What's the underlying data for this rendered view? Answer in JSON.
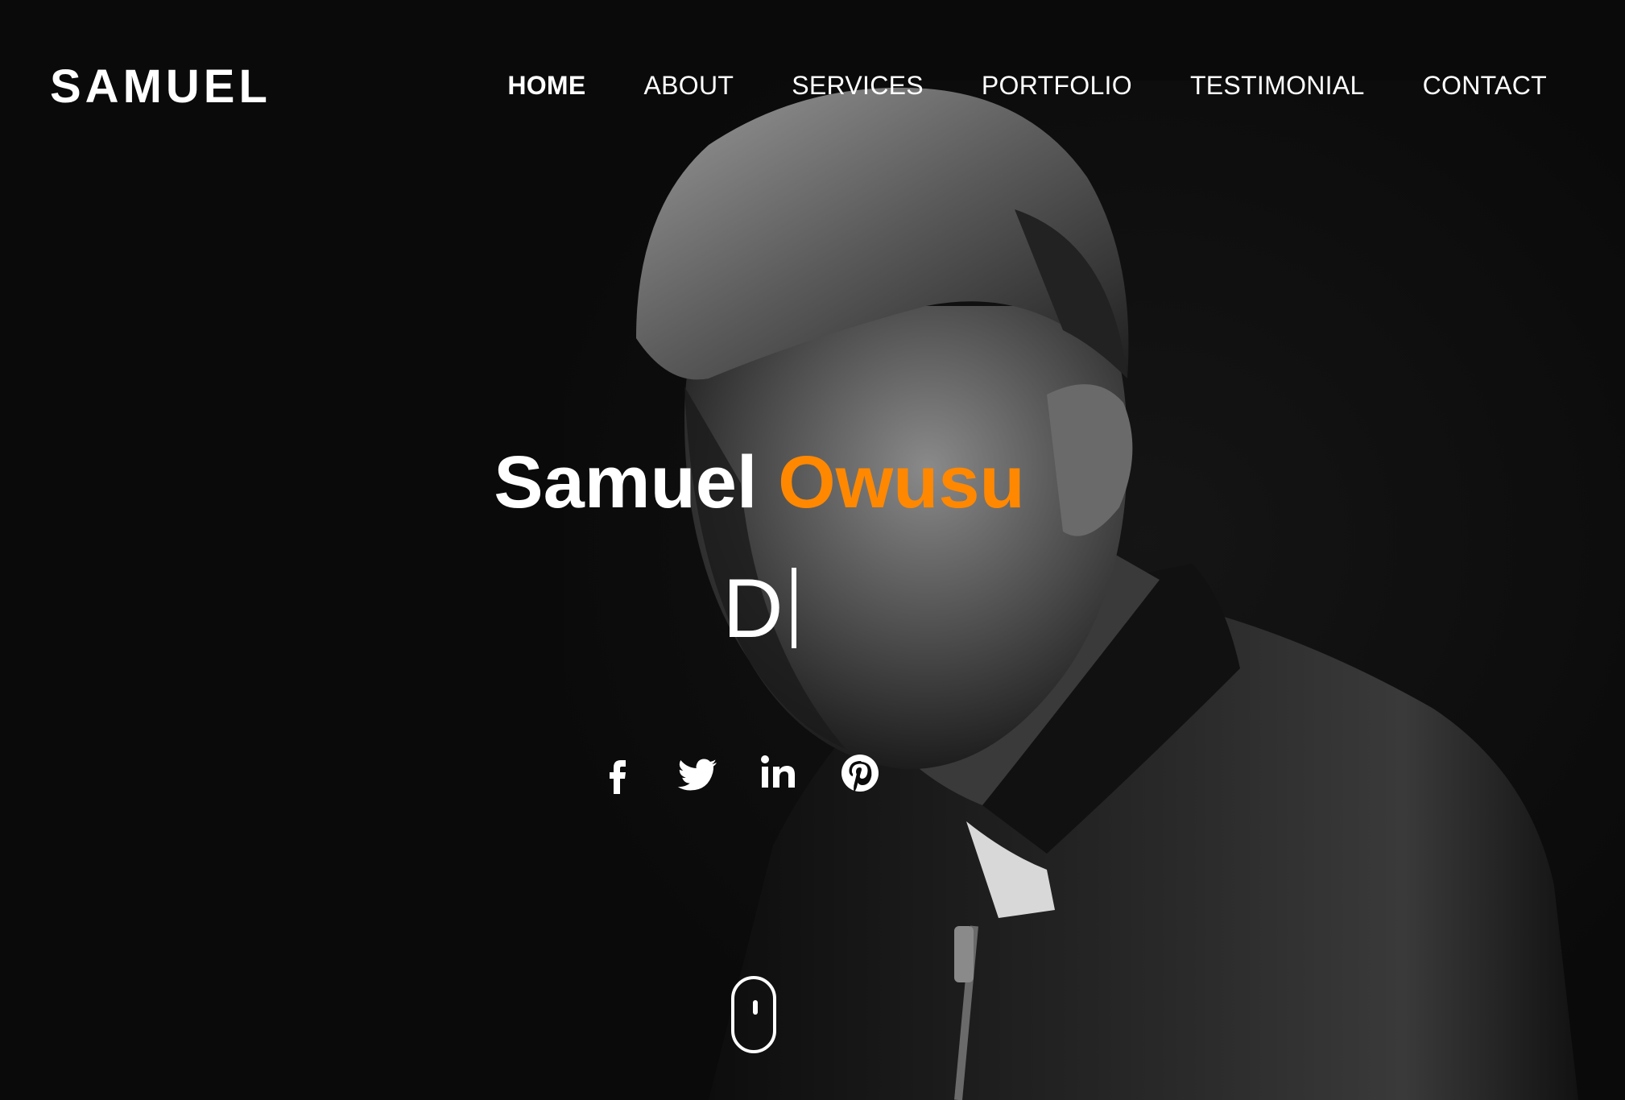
{
  "brand": {
    "logo": "SAMUEL"
  },
  "nav": {
    "items": [
      {
        "label": "HOME",
        "active": true
      },
      {
        "label": "ABOUT",
        "active": false
      },
      {
        "label": "SERVICES",
        "active": false
      },
      {
        "label": "PORTFOLIO",
        "active": false
      },
      {
        "label": "TESTIMONIAL",
        "active": false
      },
      {
        "label": "CONTACT",
        "active": false
      }
    ]
  },
  "hero": {
    "first_name": "Samuel",
    "last_name": "Owusu",
    "typed_text": "D",
    "accent_color": "#ff8800",
    "background_color": "#0a0a0a"
  },
  "social": {
    "icons": [
      "facebook-icon",
      "twitter-icon",
      "linkedin-icon",
      "pinterest-icon"
    ]
  },
  "scroll_indicator": {
    "icon": "mouse-scroll-icon"
  }
}
